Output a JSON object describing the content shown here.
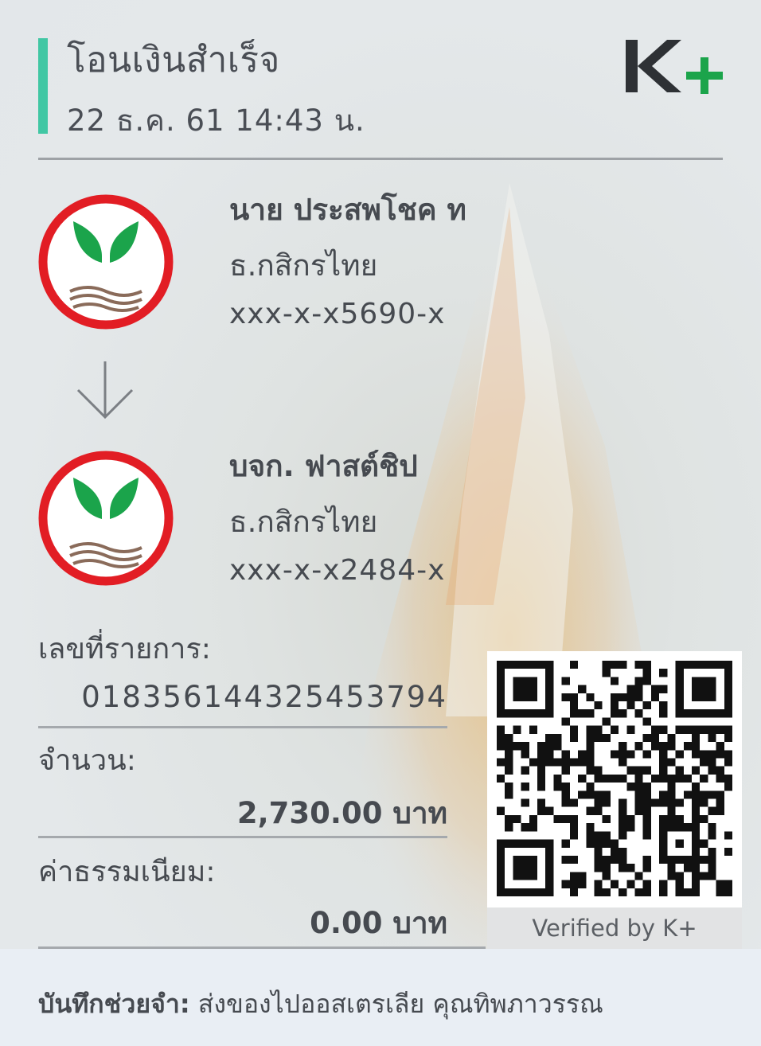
{
  "header": {
    "title": "โอนเงินสำเร็จ",
    "datetime": "22 ธ.ค. 61  14:43 น.",
    "brand_logo": "K+"
  },
  "sender": {
    "name": "นาย ประสพโชค ท",
    "bank": "ธ.กสิกรไทย",
    "account": "xxx-x-x5690-x",
    "logo_icon": "kasikorn-bank-icon"
  },
  "receiver": {
    "name": "บจก. ฟาสต์ชิป",
    "bank": "ธ.กสิกรไทย",
    "account": "xxx-x-x2484-x",
    "logo_icon": "kasikorn-bank-icon"
  },
  "details": {
    "ref_label": "เลขที่รายการ:",
    "ref_value": "018356144325453794",
    "amount_label": "จำนวน:",
    "amount_value": "2,730.00 บาท",
    "fee_label": "ค่าธรรมเนียม:",
    "fee_value": "0.00 บาท"
  },
  "qr": {
    "caption": "Verified by K+"
  },
  "memo": {
    "label": "บันทึกช่วยจำ:",
    "text": " ส่งของไปออสเตรเลีย คุณทิพภาวรรณ"
  },
  "colors": {
    "accent": "#41c7a4",
    "kbank_green": "#1ba44b",
    "kbank_red": "#e21d24",
    "brand_dark": "#2e3135"
  }
}
